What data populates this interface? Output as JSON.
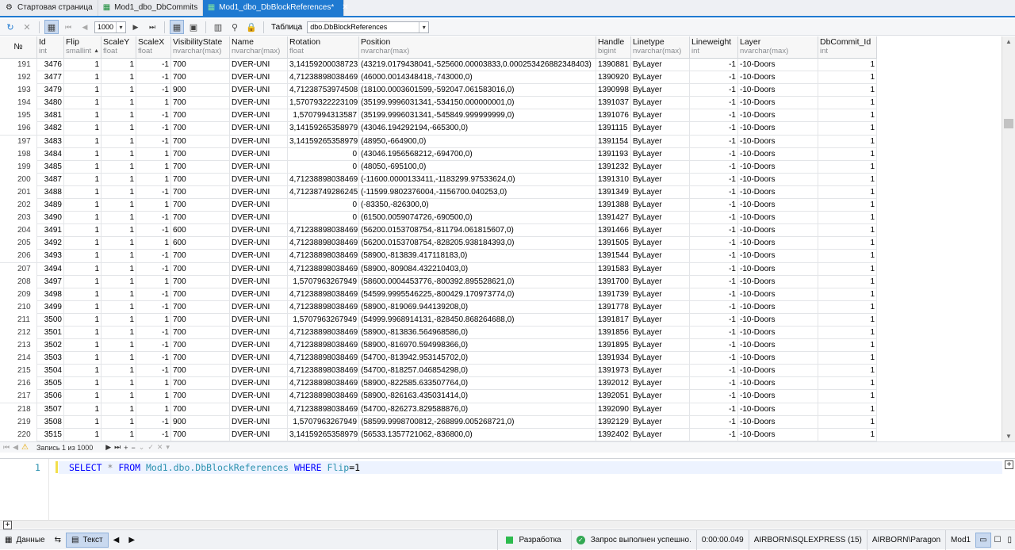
{
  "tabs": [
    {
      "label": "Стартовая страница",
      "icon": "gear-icon",
      "active": false
    },
    {
      "label": "Mod1_dbo_DbCommits",
      "icon": "table-icon",
      "active": false
    },
    {
      "label": "Mod1_dbo_DbBlockReferences*",
      "icon": "table-icon",
      "active": true
    }
  ],
  "toolbar": {
    "page_size": "1000",
    "table_label": "Таблица",
    "table_value": "dbo.DbBlockReferences"
  },
  "columns": [
    {
      "name": "№",
      "type": ""
    },
    {
      "name": "Id",
      "type": "int"
    },
    {
      "name": "Flip",
      "type": "smallint",
      "sorted": true
    },
    {
      "name": "ScaleY",
      "type": "float"
    },
    {
      "name": "ScaleX",
      "type": "float"
    },
    {
      "name": "VisibilityState",
      "type": "nvarchar(max)"
    },
    {
      "name": "Name",
      "type": "nvarchar(max)"
    },
    {
      "name": "Rotation",
      "type": "float"
    },
    {
      "name": "Position",
      "type": "nvarchar(max)"
    },
    {
      "name": "Handle",
      "type": "bigint"
    },
    {
      "name": "Linetype",
      "type": "nvarchar(max)"
    },
    {
      "name": "Lineweight",
      "type": "int"
    },
    {
      "name": "Layer",
      "type": "nvarchar(max)"
    },
    {
      "name": "DbCommit_Id",
      "type": "int"
    }
  ],
  "rows": [
    [
      "191",
      "3476",
      "1",
      "1",
      "-1",
      "700",
      "DVER-UNI",
      "3,14159200038723",
      "(43219.0179438041,-525600.00003833,0.000253426882348403)",
      "1390881",
      "ByLayer",
      "-1",
      "-10-Doors",
      "1"
    ],
    [
      "192",
      "3477",
      "1",
      "1",
      "-1",
      "700",
      "DVER-UNI",
      "4,71238898038469",
      "(46000.0014348418,-743000,0)",
      "1390920",
      "ByLayer",
      "-1",
      "-10-Doors",
      "1"
    ],
    [
      "193",
      "3479",
      "1",
      "1",
      "-1",
      "900",
      "DVER-UNI",
      "4,71238753974508",
      "(18100.0003601599,-592047.061583016,0)",
      "1390998",
      "ByLayer",
      "-1",
      "-10-Doors",
      "1"
    ],
    [
      "194",
      "3480",
      "1",
      "1",
      "1",
      "700",
      "DVER-UNI",
      "1,57079322223109",
      "(35199.9996031341,-534150.000000001,0)",
      "1391037",
      "ByLayer",
      "-1",
      "-10-Doors",
      "1"
    ],
    [
      "195",
      "3481",
      "1",
      "1",
      "-1",
      "700",
      "DVER-UNI",
      "1,5707994313587",
      "(35199.9996031341,-545849.999999999,0)",
      "1391076",
      "ByLayer",
      "-1",
      "-10-Doors",
      "1"
    ],
    [
      "196",
      "3482",
      "1",
      "1",
      "-1",
      "700",
      "DVER-UNI",
      "3,14159265358979",
      "(43046.194292194,-665300,0)",
      "1391115",
      "ByLayer",
      "-1",
      "-10-Doors",
      "1"
    ],
    [
      "197",
      "3483",
      "1",
      "1",
      "-1",
      "700",
      "DVER-UNI",
      "3,14159265358979",
      "(48950,-664900,0)",
      "1391154",
      "ByLayer",
      "-1",
      "-10-Doors",
      "1"
    ],
    [
      "198",
      "3484",
      "1",
      "1",
      "1",
      "700",
      "DVER-UNI",
      "0",
      "(43046.1956568212,-694700,0)",
      "1391193",
      "ByLayer",
      "-1",
      "-10-Doors",
      "1"
    ],
    [
      "199",
      "3485",
      "1",
      "1",
      "1",
      "700",
      "DVER-UNI",
      "0",
      "(48050,-695100,0)",
      "1391232",
      "ByLayer",
      "-1",
      "-10-Doors",
      "1"
    ],
    [
      "200",
      "3487",
      "1",
      "1",
      "1",
      "700",
      "DVER-UNI",
      "4,71238898038469",
      "(-11600.0000133411,-1183299.97533624,0)",
      "1391310",
      "ByLayer",
      "-1",
      "-10-Doors",
      "1"
    ],
    [
      "201",
      "3488",
      "1",
      "1",
      "-1",
      "700",
      "DVER-UNI",
      "4,71238749286245",
      "(-11599.9802376004,-1156700.040253,0)",
      "1391349",
      "ByLayer",
      "-1",
      "-10-Doors",
      "1"
    ],
    [
      "202",
      "3489",
      "1",
      "1",
      "1",
      "700",
      "DVER-UNI",
      "0",
      "(-83350,-826300,0)",
      "1391388",
      "ByLayer",
      "-1",
      "-10-Doors",
      "1"
    ],
    [
      "203",
      "3490",
      "1",
      "1",
      "-1",
      "700",
      "DVER-UNI",
      "0",
      "(61500.0059074726,-690500,0)",
      "1391427",
      "ByLayer",
      "-1",
      "-10-Doors",
      "1"
    ],
    [
      "204",
      "3491",
      "1",
      "1",
      "-1",
      "600",
      "DVER-UNI",
      "4,71238898038469",
      "(56200.0153708754,-811794.061815607,0)",
      "1391466",
      "ByLayer",
      "-1",
      "-10-Doors",
      "1"
    ],
    [
      "205",
      "3492",
      "1",
      "1",
      "1",
      "600",
      "DVER-UNI",
      "4,71238898038469",
      "(56200.0153708754,-828205.938184393,0)",
      "1391505",
      "ByLayer",
      "-1",
      "-10-Doors",
      "1"
    ],
    [
      "206",
      "3493",
      "1",
      "1",
      "-1",
      "700",
      "DVER-UNI",
      "4,71238898038469",
      "(58900,-813839.417118183,0)",
      "1391544",
      "ByLayer",
      "-1",
      "-10-Doors",
      "1"
    ],
    [
      "207",
      "3494",
      "1",
      "1",
      "-1",
      "700",
      "DVER-UNI",
      "4,71238898038469",
      "(58900,-809084.432210403,0)",
      "1391583",
      "ByLayer",
      "-1",
      "-10-Doors",
      "1"
    ],
    [
      "208",
      "3497",
      "1",
      "1",
      "1",
      "700",
      "DVER-UNI",
      "1,5707963267949",
      "(58600.0004453776,-800392.895528621,0)",
      "1391700",
      "ByLayer",
      "-1",
      "-10-Doors",
      "1"
    ],
    [
      "209",
      "3498",
      "1",
      "1",
      "-1",
      "700",
      "DVER-UNI",
      "4,71238898038469",
      "(54599.9995546225,-800429.170973774,0)",
      "1391739",
      "ByLayer",
      "-1",
      "-10-Doors",
      "1"
    ],
    [
      "210",
      "3499",
      "1",
      "1",
      "-1",
      "700",
      "DVER-UNI",
      "4,71238898038469",
      "(58900,-819069.944139208,0)",
      "1391778",
      "ByLayer",
      "-1",
      "-10-Doors",
      "1"
    ],
    [
      "211",
      "3500",
      "1",
      "1",
      "1",
      "700",
      "DVER-UNI",
      "1,5707963267949",
      "(54999.9968914131,-828450.868264688,0)",
      "1391817",
      "ByLayer",
      "-1",
      "-10-Doors",
      "1"
    ],
    [
      "212",
      "3501",
      "1",
      "1",
      "-1",
      "700",
      "DVER-UNI",
      "4,71238898038469",
      "(58900,-813836.564968586,0)",
      "1391856",
      "ByLayer",
      "-1",
      "-10-Doors",
      "1"
    ],
    [
      "213",
      "3502",
      "1",
      "1",
      "-1",
      "700",
      "DVER-UNI",
      "4,71238898038469",
      "(58900,-816970.594998366,0)",
      "1391895",
      "ByLayer",
      "-1",
      "-10-Doors",
      "1"
    ],
    [
      "214",
      "3503",
      "1",
      "1",
      "-1",
      "700",
      "DVER-UNI",
      "4,71238898038469",
      "(54700,-813942.953145702,0)",
      "1391934",
      "ByLayer",
      "-1",
      "-10-Doors",
      "1"
    ],
    [
      "215",
      "3504",
      "1",
      "1",
      "-1",
      "700",
      "DVER-UNI",
      "4,71238898038469",
      "(54700,-818257.046854298,0)",
      "1391973",
      "ByLayer",
      "-1",
      "-10-Doors",
      "1"
    ],
    [
      "216",
      "3505",
      "1",
      "1",
      "1",
      "700",
      "DVER-UNI",
      "4,71238898038469",
      "(58900,-822585.633507764,0)",
      "1392012",
      "ByLayer",
      "-1",
      "-10-Doors",
      "1"
    ],
    [
      "217",
      "3506",
      "1",
      "1",
      "1",
      "700",
      "DVER-UNI",
      "4,71238898038469",
      "(58900,-826163.435031414,0)",
      "1392051",
      "ByLayer",
      "-1",
      "-10-Doors",
      "1"
    ],
    [
      "218",
      "3507",
      "1",
      "1",
      "1",
      "700",
      "DVER-UNI",
      "4,71238898038469",
      "(54700,-826273.829588876,0)",
      "1392090",
      "ByLayer",
      "-1",
      "-10-Doors",
      "1"
    ],
    [
      "219",
      "3508",
      "1",
      "1",
      "-1",
      "900",
      "DVER-UNI",
      "1,5707963267949",
      "(58599.9998700812,-268899.005268721,0)",
      "1392129",
      "ByLayer",
      "-1",
      "-10-Doors",
      "1"
    ],
    [
      "220",
      "3515",
      "1",
      "1",
      "-1",
      "700",
      "DVER-UNI",
      "3,14159265358979",
      "(56533.1357721062,-836800,0)",
      "1392402",
      "ByLayer",
      "-1",
      "-10-Doors",
      "1"
    ]
  ],
  "navbar": {
    "record_text": "Запись 1 из 1000"
  },
  "editor": {
    "line_number": "1",
    "sql_select": "SELECT",
    "sql_star": "*",
    "sql_from": "FROM",
    "sql_table": "Mod1.dbo.DbBlockReferences",
    "sql_where": "WHERE",
    "sql_col": "Flip",
    "sql_eq": "=1"
  },
  "status": {
    "data_label": "Данные",
    "text_label": "Текст",
    "env": "Разработка",
    "query_status": "Запрос выполнен успешно.",
    "elapsed": "0:00:00.049",
    "server": "AIRBORN\\SQLEXPRESS (15)",
    "user": "AIRBORN\\Paragon",
    "database": "Mod1"
  },
  "colors": {
    "accent": "#1f7ad1",
    "env_green": "#2dbb4e",
    "success": "#33a853"
  }
}
